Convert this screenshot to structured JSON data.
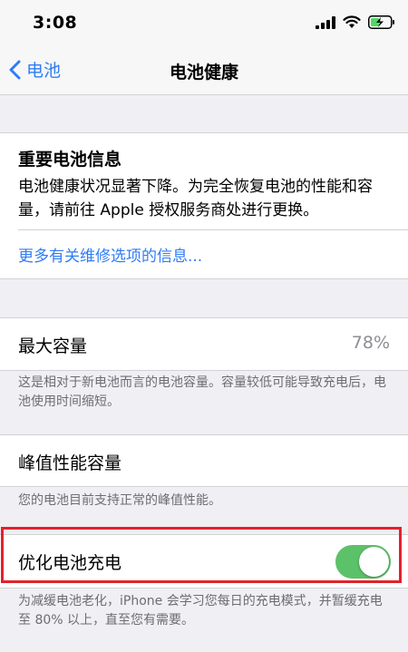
{
  "status": {
    "time": "3:08"
  },
  "nav": {
    "back_label": "电池",
    "title": "电池健康"
  },
  "notice": {
    "title": "重要电池信息",
    "body": "电池健康状况显著下降。为完全恢复电池的性能和容量，请前往 Apple 授权服务商处进行更换。",
    "link": "更多有关维修选项的信息..."
  },
  "max_capacity": {
    "label": "最大容量",
    "value": "78%",
    "footnote": "这是相对于新电池而言的电池容量。容量较低可能导致充电后，电池使用时间缩短。"
  },
  "peak_performance": {
    "label": "峰值性能容量",
    "footnote": "您的电池目前支持正常的峰值性能。"
  },
  "optimized_charging": {
    "label": "优化电池充电",
    "enabled": true,
    "footnote": "为减缓电池老化，iPhone 会学习您每日的充电模式，并暂缓充电至 80% 以上，直至您有需要。"
  },
  "colors": {
    "accent": "#2f7cf6",
    "toggle_on": "#5cc26a",
    "highlight": "#e3212c"
  }
}
